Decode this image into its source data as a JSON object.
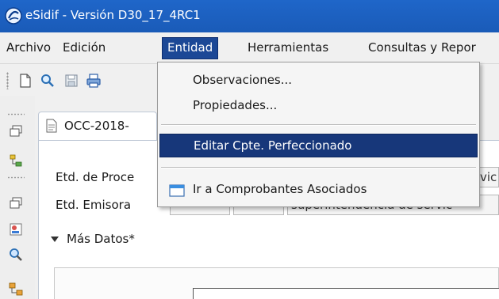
{
  "window": {
    "title": "eSidif - Versión D30_17_4RC1"
  },
  "menubar": {
    "items": [
      {
        "label": "Archivo"
      },
      {
        "label": "Edición"
      },
      {
        "label": "Entidad",
        "active": true
      },
      {
        "label": "Herramientas"
      },
      {
        "label": "Consultas y Repor"
      }
    ]
  },
  "toolbar": {
    "icons": [
      "new-document-icon",
      "search-icon",
      "save-icon",
      "print-icon"
    ]
  },
  "leftbar": {
    "icons": [
      "restore-icon",
      "tree-icon",
      "restore-icon",
      "user-list-icon",
      "magnify-icon",
      "hierarchy-icon"
    ]
  },
  "editor": {
    "tab_label": "OCC-2018-",
    "fields": {
      "etd_procesadora_label": "Etd. de Proce",
      "etd_procesadora_value": "vic",
      "etd_emisora_label": "Etd. Emisora",
      "etd_emisora_values": [
        "",
        "",
        "superintendencia de servic"
      ]
    },
    "more_data_label": "Más Datos*"
  },
  "dropdown": {
    "items": [
      {
        "label": "Observaciones..."
      },
      {
        "label": "Propiedades..."
      },
      {
        "label": "Editar Cpte. Perfeccionado",
        "selected": true
      },
      {
        "label": "Ir a Comprobantes Asociados",
        "icon": "window-icon"
      }
    ]
  },
  "colors": {
    "titlebar": "#1f66c9",
    "selection": "#17377a",
    "active_menu": "#1c4896"
  }
}
